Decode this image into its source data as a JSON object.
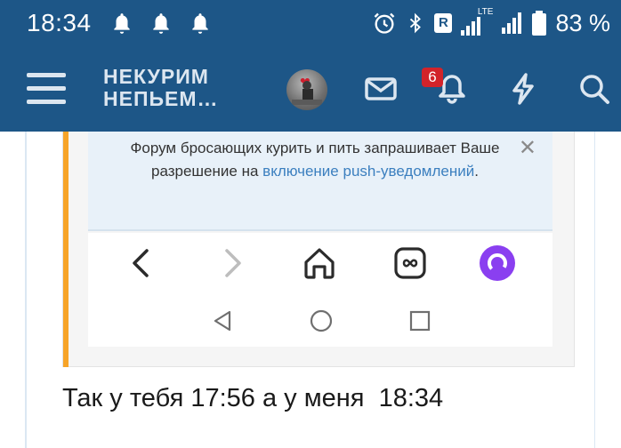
{
  "status_bar": {
    "time": "18:34",
    "notification_icons": [
      "bell-icon",
      "bell-icon",
      "bell-icon"
    ],
    "right_icons": [
      "alarm-icon",
      "bluetooth-icon",
      "r-badge-icon",
      "signal-lte-icon",
      "signal-icon",
      "battery-icon"
    ],
    "lte_label": "LTE",
    "r_label": "R",
    "battery_text": "83 %"
  },
  "header": {
    "brand_line1": "НЕКУРИМ",
    "brand_line2": "НЕПЬЕМ…",
    "notification_count": "6",
    "icons": [
      "menu-icon",
      "avatar",
      "mail-icon",
      "bell-icon",
      "lightning-icon",
      "search-icon"
    ]
  },
  "notice": {
    "text_before": "Форум бросающих курить и пить запрашивает Ваше разрешение на ",
    "link_text": "включение push-уведомлений",
    "text_after": ".",
    "close_glyph": "✕"
  },
  "browser_nav": {
    "icons": [
      "back-arrow-icon",
      "forward-arrow-icon",
      "home-icon",
      "tabs-icon",
      "alice-assistant-icon"
    ],
    "system_icons": [
      "system-back-icon",
      "system-home-icon",
      "system-recents-icon"
    ]
  },
  "post": {
    "message": "Так у тебя 17:56 а у меня  18:34"
  },
  "colors": {
    "header_bg": "#1d5687",
    "quote_accent": "#f7a428",
    "notice_bg": "#e8f1f9",
    "link": "#3b7fbf",
    "badge": "#d2232a",
    "alice": "#8a3ff0"
  }
}
